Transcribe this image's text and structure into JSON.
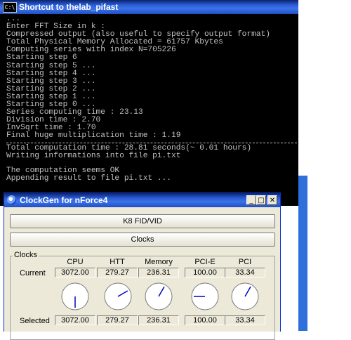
{
  "console": {
    "title": "Shortcut to thelab_pifast",
    "icon": "C:\\",
    "lines_top": [
      "...",
      "Enter FFT Size in k :",
      "Compressed output (also useful to specify output format)",
      "Total Physical Memory Allocated = 61757 Kbytes",
      "Computing series with index N=705226",
      "Starting step 6",
      "Starting step 5 ...",
      "Starting step 4 ...",
      "Starting step 3 ...",
      "Starting step 2 ...",
      "Starting step 1 ...",
      "Starting step 0 ...",
      "Series computing time : 23.13",
      "Division time : 2.70",
      "InvSqrt time : 1.70",
      "Final huge multiplication time : 1.19"
    ],
    "lines_mid": [
      "Total computation time : 28.81 seconds(~ 0.01 hours)",
      "Writing informations into file pi.txt"
    ],
    "lines_bottom": [
      "The computation seems OK",
      "Appending result to file pi.txt ..."
    ]
  },
  "clockgen": {
    "title": "ClockGen for nForce4",
    "controls": {
      "minimize": "_",
      "maximize": "□",
      "close": "✕"
    },
    "k8_button": "K8 FID/VID",
    "clocks_button": "Clocks",
    "group_label": "Clocks",
    "columns": [
      "CPU",
      "HTT",
      "Memory",
      "PCI-E",
      "PCI"
    ],
    "current_label": "Current",
    "selected_label": "Selected",
    "current": [
      "3072.00",
      "279.27",
      "236.31",
      "100.00",
      "33.34"
    ],
    "selected": [
      "3072.00",
      "279.27",
      "236.31",
      "100.00",
      "33.34"
    ],
    "dial_angles_deg": [
      180,
      60,
      30,
      270,
      30
    ]
  }
}
